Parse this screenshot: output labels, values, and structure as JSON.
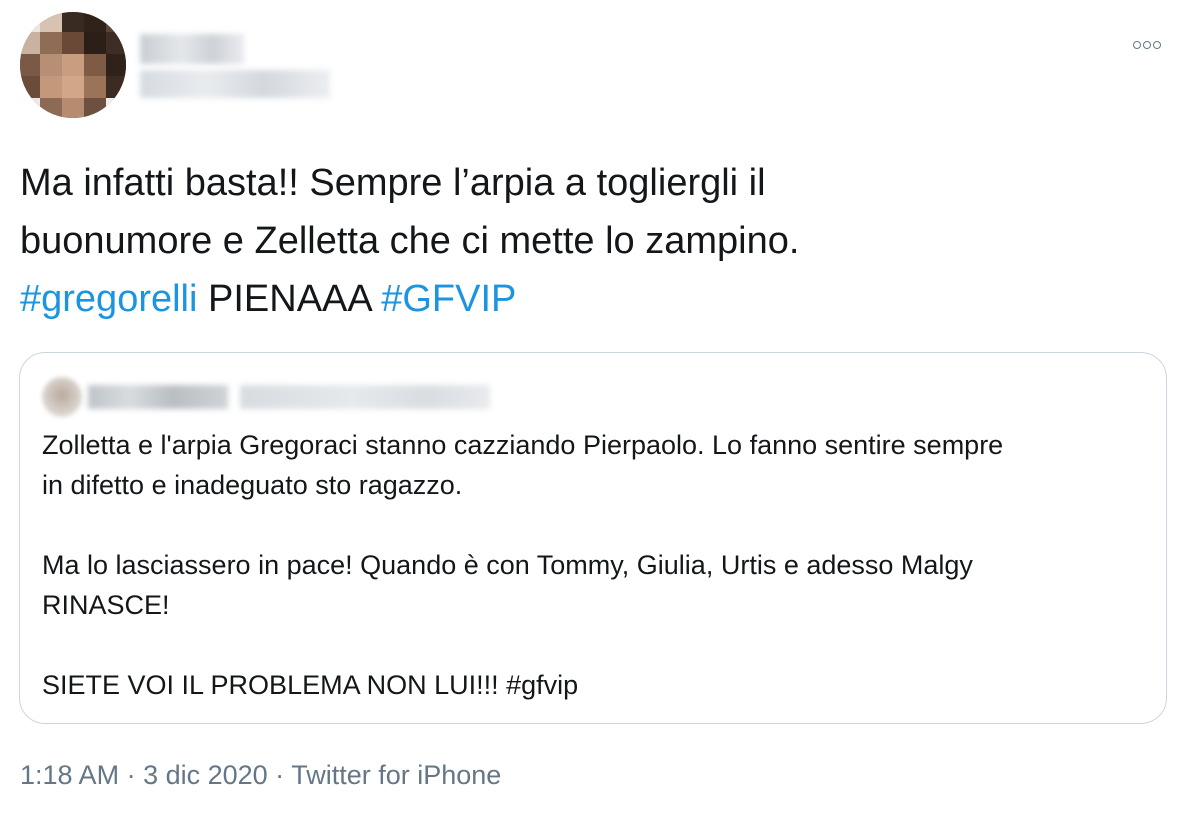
{
  "header": {
    "more_icon": "more-options-icon"
  },
  "tweet": {
    "line1": "Ma infatti basta!! Sempre l’arpia a togliergli il",
    "line2": "buonumore e Zelletta che ci mette lo zampino.",
    "hashtag1": "#gregorelli",
    "middle": " PIENAAA ",
    "hashtag2": "#GFVIP"
  },
  "quote": {
    "p1_line1": "Zolletta e l'arpia Gregoraci stanno cazziando Pierpaolo. Lo fanno sentire sempre",
    "p1_line2": "in difetto e inadeguato sto ragazzo.",
    "p2_line1": "Ma lo lasciassero in pace! Quando è con Tommy, Giulia, Urtis e adesso Malgy",
    "p2_line2": "RINASCE!",
    "p3_line1": "SIETE VOI IL PROBLEMA NON LUI!!! #gfvip"
  },
  "meta": {
    "time": "1:18 AM",
    "sep1": " · ",
    "date": "3 dic 2020",
    "sep2": " · ",
    "source": "Twitter for iPhone"
  },
  "colors": {
    "hashtag": "#1b95e0",
    "text": "#14171a",
    "secondary": "#657786",
    "border": "#ccd6dd"
  }
}
